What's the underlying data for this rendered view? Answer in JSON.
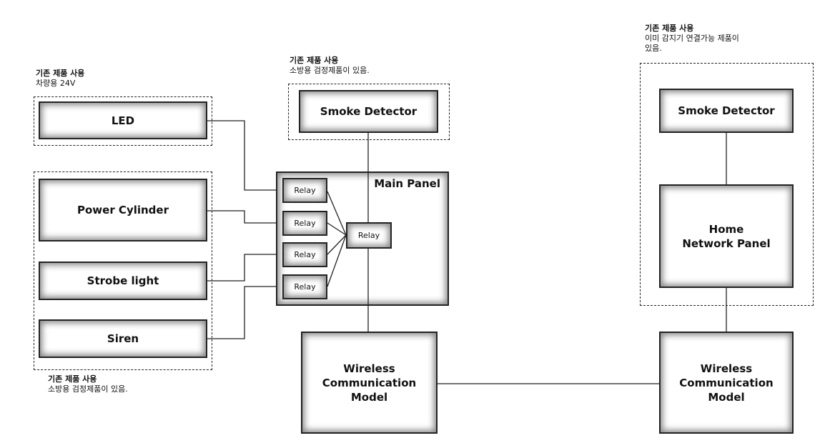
{
  "notes": {
    "led_group": {
      "title": "기존 제품 사용",
      "text": "차량용 24V"
    },
    "smoke_left": {
      "title": "기존 제품 사용",
      "text": "소방용 검정제품이 있음."
    },
    "home_group": {
      "title": "기존 제품 사용",
      "text": "이미 감지기 연결가능 제품이",
      "text2": "있음."
    },
    "alarm_group": {
      "title": "기존 제품 사용",
      "text": "소방용 검정제품이 있음."
    }
  },
  "nodes": {
    "led": "LED",
    "power_cylinder": "Power Cylinder",
    "strobe": "Strobe light",
    "siren": "Siren",
    "smoke_left": "Smoke Detector",
    "main_panel": "Main Panel",
    "relay": "Relay",
    "wireless_left": "Wireless Communication Model",
    "smoke_right": "Smoke Detector",
    "home_panel": "Home Network Panel",
    "wireless_right": "Wireless Communication Model"
  }
}
